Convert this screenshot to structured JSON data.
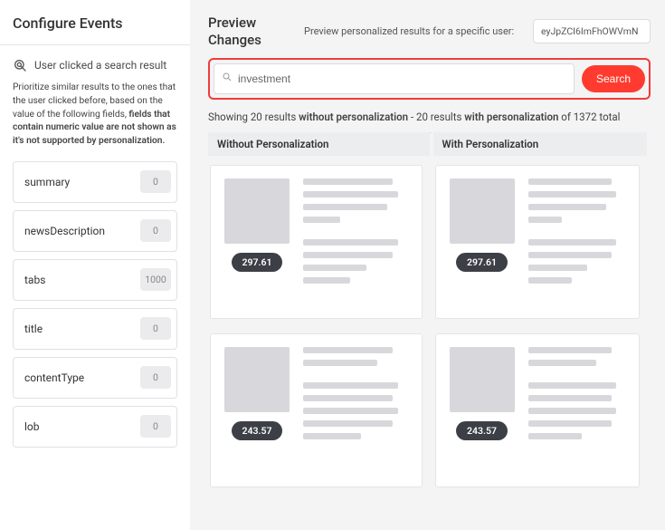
{
  "sidebar": {
    "title": "Configure Events",
    "event": {
      "icon": "click-target-icon",
      "label": "User clicked a search result"
    },
    "description_plain": "Prioritize similar results to the ones that the user clicked before, based on the value of the following fields, ",
    "description_bold": "fields that contain numeric value are not shown as it's not supported by personalization.",
    "fields": [
      {
        "name": "summary",
        "value": "0"
      },
      {
        "name": "newsDescription",
        "value": "0"
      },
      {
        "name": "tabs",
        "value": "1000"
      },
      {
        "name": "title",
        "value": "0"
      },
      {
        "name": "contentType",
        "value": "0"
      },
      {
        "name": "lob",
        "value": "0"
      }
    ]
  },
  "preview": {
    "title": "Preview Changes",
    "subtitle": "Preview personalized results for a specific user:",
    "user_token": "eyJpZCI6ImFhOWVmN",
    "search_value": "investment",
    "search_button": "Search",
    "summary": {
      "showing": "Showing 20 results ",
      "without_bold": "without personalization",
      "mid": " - 20 results ",
      "with_bold": "with personalization",
      "tail": " of 1372 total"
    },
    "columns": {
      "without": "Without Personalization",
      "with": "With Personalization"
    },
    "results_without": [
      {
        "score": "297.61"
      },
      {
        "score": "243.57"
      }
    ],
    "results_with": [
      {
        "score": "297.61"
      },
      {
        "score": "243.57"
      }
    ]
  }
}
